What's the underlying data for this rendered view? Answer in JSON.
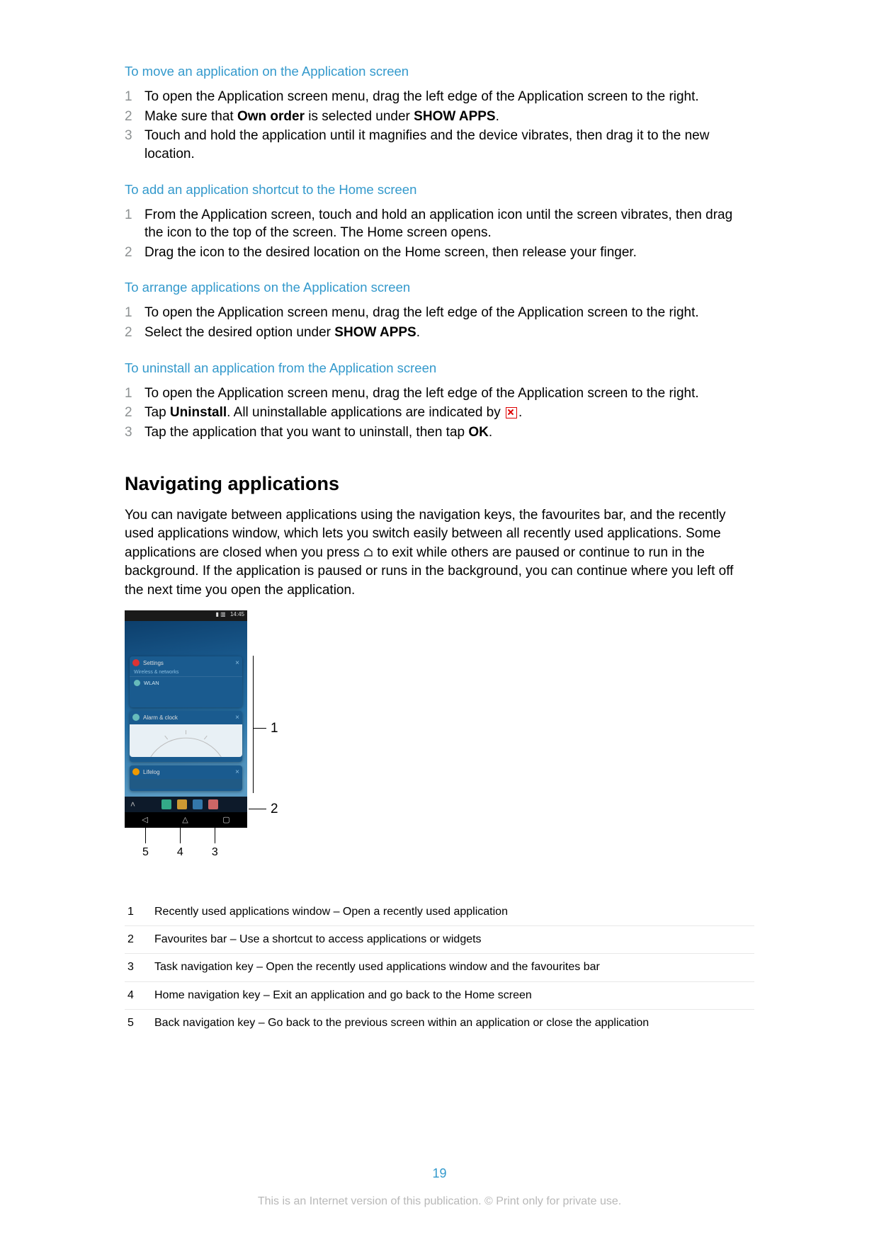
{
  "sections": [
    {
      "title": "To move an application on the Application screen",
      "steps": [
        {
          "n": "1",
          "parts": [
            {
              "t": "To open the Application screen menu, drag the left edge of the Application screen to the right."
            }
          ]
        },
        {
          "n": "2",
          "parts": [
            {
              "t": "Make sure that "
            },
            {
              "t": "Own order",
              "b": true
            },
            {
              "t": " is selected under "
            },
            {
              "t": "SHOW APPS",
              "b": true
            },
            {
              "t": "."
            }
          ]
        },
        {
          "n": "3",
          "parts": [
            {
              "t": "Touch and hold the application until it magnifies and the device vibrates, then drag it to the new location."
            }
          ]
        }
      ]
    },
    {
      "title": "To add an application shortcut to the Home screen",
      "steps": [
        {
          "n": "1",
          "parts": [
            {
              "t": "From the Application screen, touch and hold an application icon until the screen vibrates, then drag the icon to the top of the screen. The Home screen opens."
            }
          ]
        },
        {
          "n": "2",
          "parts": [
            {
              "t": "Drag the icon to the desired location on the Home screen, then release your finger."
            }
          ]
        }
      ]
    },
    {
      "title": "To arrange applications on the Application screen",
      "steps": [
        {
          "n": "1",
          "parts": [
            {
              "t": "To open the Application screen menu, drag the left edge of the Application screen to the right."
            }
          ]
        },
        {
          "n": "2",
          "parts": [
            {
              "t": "Select the desired option under "
            },
            {
              "t": "SHOW APPS",
              "b": true
            },
            {
              "t": "."
            }
          ]
        }
      ]
    },
    {
      "title": "To uninstall an application from the Application screen",
      "steps": [
        {
          "n": "1",
          "parts": [
            {
              "t": "To open the Application screen menu, drag the left edge of the Application screen to the right."
            }
          ]
        },
        {
          "n": "2",
          "parts": [
            {
              "t": "Tap "
            },
            {
              "t": "Uninstall",
              "b": true
            },
            {
              "t": ". All uninstallable applications are indicated by "
            },
            {
              "icon": "uninstall-x-icon"
            },
            {
              "t": "."
            }
          ]
        },
        {
          "n": "3",
          "parts": [
            {
              "t": "Tap the application that you want to uninstall, then tap "
            },
            {
              "t": "OK",
              "b": true
            },
            {
              "t": "."
            }
          ]
        }
      ]
    }
  ],
  "h1": "Navigating applications",
  "para": {
    "pre": "You can navigate between applications using the navigation keys, the favourites bar, and the recently used applications window, which lets you switch easily between all recently used applications. Some applications are closed when you press ",
    "post": " to exit while others are paused or continue to run in the background. If the application is paused or runs in the background, you can continue where you left off the next time you open the application."
  },
  "phone": {
    "time": "14:45",
    "status_icons": "▮ ▥",
    "cards": {
      "settings": {
        "label": "Settings",
        "sub": "Wireless & networks",
        "row": "WLAN"
      },
      "alarm": {
        "label": "Alarm & clock"
      },
      "lifelog": {
        "label": "Lifelog"
      }
    },
    "nav": {
      "back": "◁",
      "home": "△",
      "task": "▢"
    }
  },
  "callouts": {
    "c1": "1",
    "c2": "2",
    "c3": "3",
    "c4": "4",
    "c5": "5"
  },
  "legend": [
    {
      "n": "1",
      "t": "Recently used applications window – Open a recently used application"
    },
    {
      "n": "2",
      "t": "Favourites bar – Use a shortcut to access applications or widgets"
    },
    {
      "n": "3",
      "t": "Task navigation key – Open the recently used applications window and the favourites bar"
    },
    {
      "n": "4",
      "t": "Home navigation key – Exit an application and go back to the Home screen"
    },
    {
      "n": "5",
      "t": "Back navigation key – Go back to the previous screen within an application or close the application"
    }
  ],
  "page_number": "19",
  "footer": "This is an Internet version of this publication. © Print only for private use."
}
